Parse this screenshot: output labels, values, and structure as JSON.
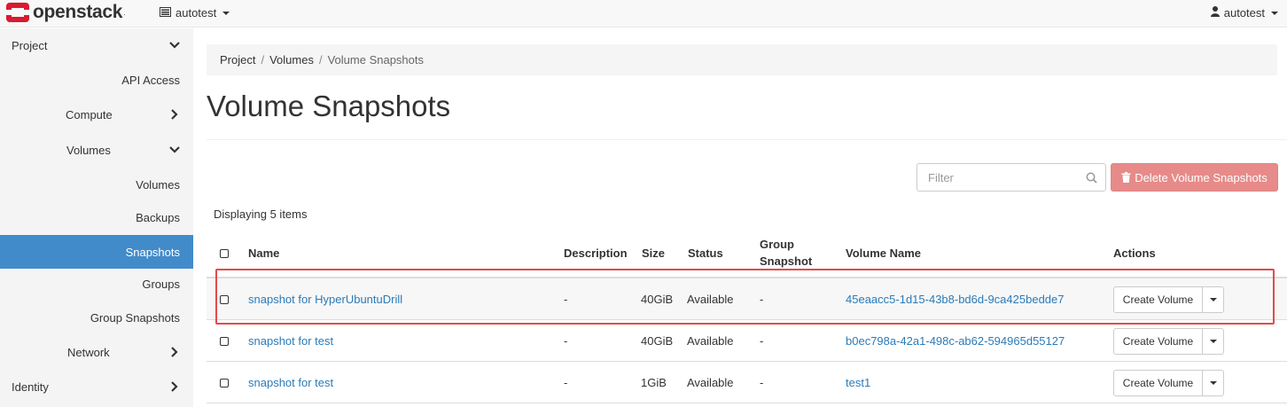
{
  "navbar": {
    "brand": "openstack",
    "brand_mark": ".",
    "project": "autotest",
    "user": "autotest",
    "brand_color": "#da1a32"
  },
  "sidebar": {
    "items": [
      {
        "label": "Project"
      },
      {
        "label": "API Access"
      },
      {
        "label": "Compute"
      },
      {
        "label": "Volumes"
      },
      {
        "label": "Volumes"
      },
      {
        "label": "Backups"
      },
      {
        "label": "Snapshots"
      },
      {
        "label": "Groups"
      },
      {
        "label": "Group Snapshots"
      },
      {
        "label": "Network"
      },
      {
        "label": "Identity"
      }
    ],
    "active_color": "#428bca"
  },
  "breadcrumb": {
    "items": [
      "Project",
      "Volumes",
      "Volume Snapshots"
    ],
    "separator": "/"
  },
  "page": {
    "title": "Volume Snapshots",
    "filter_placeholder": "Filter",
    "delete_button": "Delete Volume Snapshots",
    "count_text": "Displaying 5 items"
  },
  "table": {
    "headers": {
      "name": "Name",
      "description": "Description",
      "size": "Size",
      "status": "Status",
      "group_snapshot_1": "Group",
      "group_snapshot_2": "Snapshot",
      "volume_name": "Volume Name",
      "actions": "Actions"
    },
    "rows": [
      {
        "name": "snapshot for HyperUbuntuDrill",
        "description": "-",
        "size": "40GiB",
        "status": "Available",
        "group_snapshot": "-",
        "volume_name": "45eaacc5-1d15-43b8-bd6d-9ca425bedde7",
        "action": "Create Volume"
      },
      {
        "name": "snapshot for test",
        "description": "-",
        "size": "40GiB",
        "status": "Available",
        "group_snapshot": "-",
        "volume_name": "b0ec798a-42a1-498c-ab62-594965d55127",
        "action": "Create Volume"
      },
      {
        "name": "snapshot for test",
        "description": "-",
        "size": "1GiB",
        "status": "Available",
        "group_snapshot": "-",
        "volume_name": "test1",
        "action": "Create Volume"
      }
    ]
  }
}
